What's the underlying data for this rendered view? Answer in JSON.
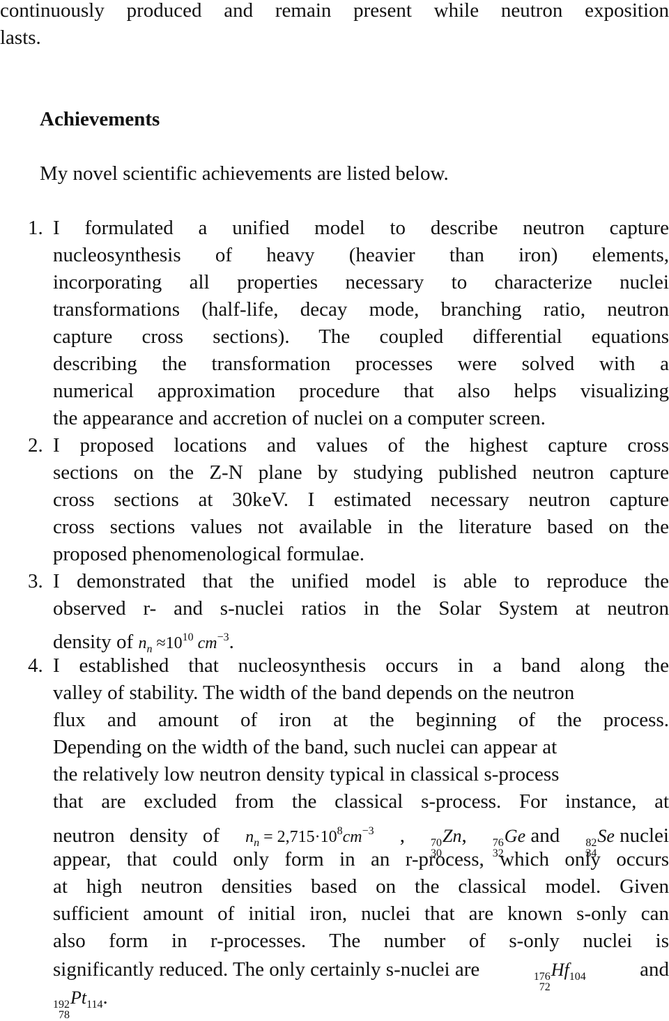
{
  "lead": {
    "line1": "continuously produced and remain present while neutron exposition",
    "line2": "lasts."
  },
  "heading": "Achievements",
  "intro": "My novel scientific achievements are listed below.",
  "items": [
    {
      "number": "1.",
      "lines": [
        "I formulated a unified model to describe neutron capture",
        "nucleosynthesis of heavy (heavier than iron) elements,",
        "incorporating all properties necessary to characterize nuclei",
        "transformations (half-life, decay mode, branching ratio, neutron",
        "capture cross sections). The coupled differential equations",
        "describing the transformation processes were solved with a",
        "numerical approximation procedure that also helps visualizing",
        "the appearance and accretion of nuclei on a computer screen."
      ]
    },
    {
      "number": "2.",
      "lines": [
        "I proposed locations and values of the highest capture cross",
        "sections on the Z-N plane by studying published neutron capture",
        "cross sections at 30keV. I estimated necessary neutron capture",
        "cross sections values not available in the literature based on the",
        "proposed phenomenological formulae."
      ]
    },
    {
      "number": "3.",
      "lines": [
        "I demonstrated that the unified model is able to reproduce the",
        "observed r- and s-nuclei ratios in the Solar System at neutron"
      ],
      "last_prefix": "density of",
      "formula": {
        "n": "n",
        "sub": "n",
        "approx": "≈",
        "base": "10",
        "exp": "10",
        "unit": "cm",
        "unit_exp": "−3",
        "end": "."
      }
    },
    {
      "number": "4.",
      "lines": [
        "I established that nucleosynthesis occurs in a band along the",
        "valley of stability. The width of the band depends on the neutron",
        "flux and amount of iron at the beginning of the process.",
        "Depending on the width of the band, such nuclei can appear at",
        "the relatively low neutron density typical in classical s-process",
        "that are excluded from the classical s-process. For instance, at"
      ],
      "density_line": {
        "prefix": "neutron density of",
        "formula": {
          "n": "n",
          "sub": "n",
          "eq": "=",
          "value": "2,715",
          "dot": "·",
          "base": "10",
          "exp": "8",
          "unit": "cm",
          "unit_exp": "−3"
        },
        "comma": ",",
        "nuclei": [
          {
            "A": "70",
            "Z": "30",
            "symbol": "Zn",
            "after": ","
          },
          {
            "A": "76",
            "Z": "32",
            "symbol": "Ge",
            "after": ""
          },
          {
            "A": "82",
            "Z": "34",
            "symbol": "Se",
            "after": ""
          }
        ],
        "and": "and",
        "suffix": "nuclei"
      },
      "more_lines": [
        "appear, that could only form in an r-process, which only occurs",
        "at high neutron densities based on the classical model. Given",
        "sufficient amount of initial iron, nuclei that are known s-only can",
        "also form in r-processes. The number of s-only nuclei is"
      ],
      "final_line": {
        "prefix": "significantly reduced. The only certainly s-nuclei are",
        "nucleus1": {
          "A": "176",
          "Z": "72",
          "symbol": "Hf",
          "N": "104"
        },
        "and": "and",
        "nucleus2": {
          "A": "192",
          "Z": "78",
          "symbol": "Pt",
          "N": "114"
        },
        "end": "."
      }
    }
  ]
}
